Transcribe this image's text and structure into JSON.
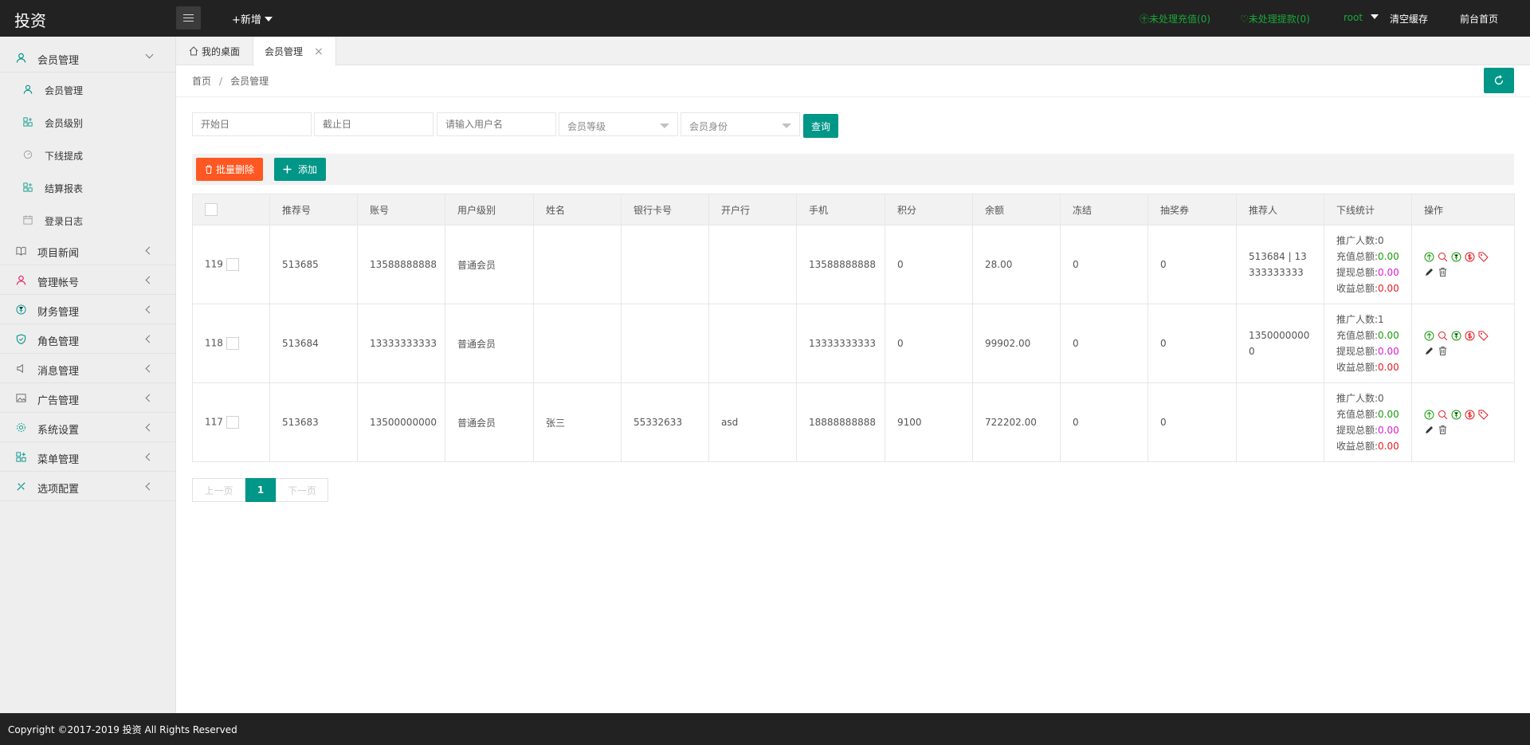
{
  "app": {
    "logo": "投资",
    "new_label": "+新增"
  },
  "header": {
    "recharge_link": "未处理充值(0)",
    "withdraw_link": "未处理提款(0)",
    "user": "root",
    "clear_cache": "清空缓存",
    "front_home": "前台首页"
  },
  "sidebar": {
    "groups": [
      {
        "label": "会员管理",
        "icon": "user-icon"
      },
      {
        "label": "项目新闻",
        "icon": "book-icon"
      },
      {
        "label": "管理帐号",
        "icon": "admin-icon"
      },
      {
        "label": "财务管理",
        "icon": "yuan-icon"
      },
      {
        "label": "角色管理",
        "icon": "shield-icon"
      },
      {
        "label": "消息管理",
        "icon": "speaker-icon"
      },
      {
        "label": "广告管理",
        "icon": "image-icon"
      },
      {
        "label": "系统设置",
        "icon": "gear-icon"
      },
      {
        "label": "菜单管理",
        "icon": "grid-icon"
      },
      {
        "label": "选项配置",
        "icon": "config-icon"
      }
    ],
    "sub_items": [
      {
        "label": "会员管理",
        "icon": "user-icon"
      },
      {
        "label": "会员级别",
        "icon": "grid-icon"
      },
      {
        "label": "下线提成",
        "icon": "gauge-icon"
      },
      {
        "label": "结算报表",
        "icon": "grid-icon"
      },
      {
        "label": "登录日志",
        "icon": "calendar-icon"
      }
    ]
  },
  "tabs": {
    "home": "我的桌面",
    "active": "会员管理",
    "close": "×"
  },
  "breadcrumb": {
    "home": "首页",
    "sep": "/",
    "current": "会员管理"
  },
  "search": {
    "start_placeholder": "开始日",
    "end_placeholder": "截止日",
    "username_placeholder": "请输入用户名",
    "level_select": "会员等级",
    "identity_select": "会员身份",
    "query": "查询"
  },
  "toolbar": {
    "batch_delete": "批量删除",
    "add": "添加"
  },
  "table": {
    "headers": [
      "推荐号",
      "账号",
      "用户级别",
      "姓名",
      "银行卡号",
      "开户行",
      "手机",
      "积分",
      "余额",
      "冻结",
      "抽奖券",
      "推荐人",
      "下线统计",
      "操作"
    ],
    "stat_labels": {
      "promoters": "推广人数:",
      "recharge": "充值总额:",
      "withdraw": "提现总额:",
      "income": "收益总额:"
    },
    "rows": [
      {
        "id": "119",
        "ref_no": "513685",
        "account": "13588888888",
        "level": "普通会员",
        "name": "",
        "bank_card": "",
        "bank": "",
        "phone": "13588888888",
        "points": "0",
        "balance": "28.00",
        "frozen": "0",
        "lottery": "0",
        "referrer": "513684 | 13333333333",
        "promoters": "0",
        "recharge": "0.00",
        "withdraw": "0.00",
        "income": "0.00"
      },
      {
        "id": "118",
        "ref_no": "513684",
        "account": "13333333333",
        "level": "普通会员",
        "name": "",
        "bank_card": "",
        "bank": "",
        "phone": "13333333333",
        "points": "0",
        "balance": "99902.00",
        "frozen": "0",
        "lottery": "0",
        "referrer": "13500000000",
        "promoters": "1",
        "recharge": "0.00",
        "withdraw": "0.00",
        "income": "0.00"
      },
      {
        "id": "117",
        "ref_no": "513683",
        "account": "13500000000",
        "level": "普通会员",
        "name": "张三",
        "bank_card": "55332633",
        "bank": "asd",
        "phone": "18888888888",
        "points": "9100",
        "balance": "722202.00",
        "frozen": "0",
        "lottery": "0",
        "referrer": "",
        "promoters": "0",
        "recharge": "0.00",
        "withdraw": "0.00",
        "income": "0.00"
      }
    ]
  },
  "pagination": {
    "prev": "上一页",
    "current": "1",
    "next": "下一页"
  },
  "footer": {
    "copyright": "Copyright ©2017-2019 投资 All Rights Reserved"
  },
  "colors": {
    "primary": "#009688",
    "danger": "#ff5722",
    "topbar": "#222222",
    "green_text": "#1aa839"
  }
}
